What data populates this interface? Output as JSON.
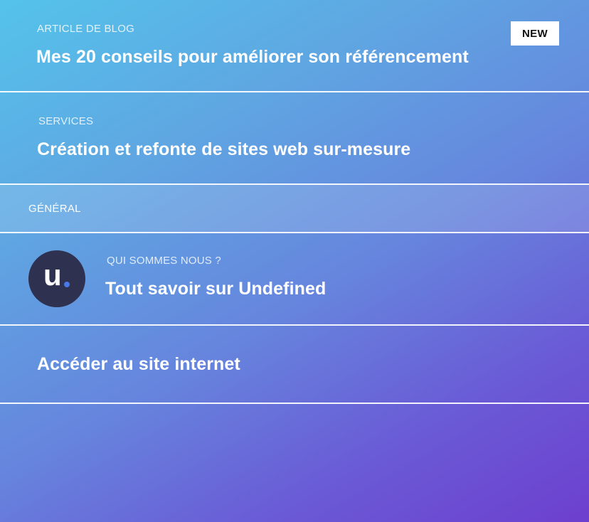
{
  "blog": {
    "kicker": "ARTICLE DE BLOG",
    "title": "Mes 20 conseils pour améliorer son référencement",
    "badge": "NEW"
  },
  "services": {
    "kicker": "SERVICES",
    "title": "Création et refonte de sites web sur-mesure"
  },
  "general": {
    "label": "GÉNÉRAL"
  },
  "about": {
    "logo_letter": "u",
    "logo_dot_color": "#4a78e8",
    "kicker": "QUI SOMMES NOUS ?",
    "title": "Tout savoir sur Undefined"
  },
  "site": {
    "title": "Accéder au site internet"
  },
  "colors": {
    "gradient_start": "#54c3ea",
    "gradient_end": "#6d3fce",
    "logo_background": "#2e3150"
  }
}
